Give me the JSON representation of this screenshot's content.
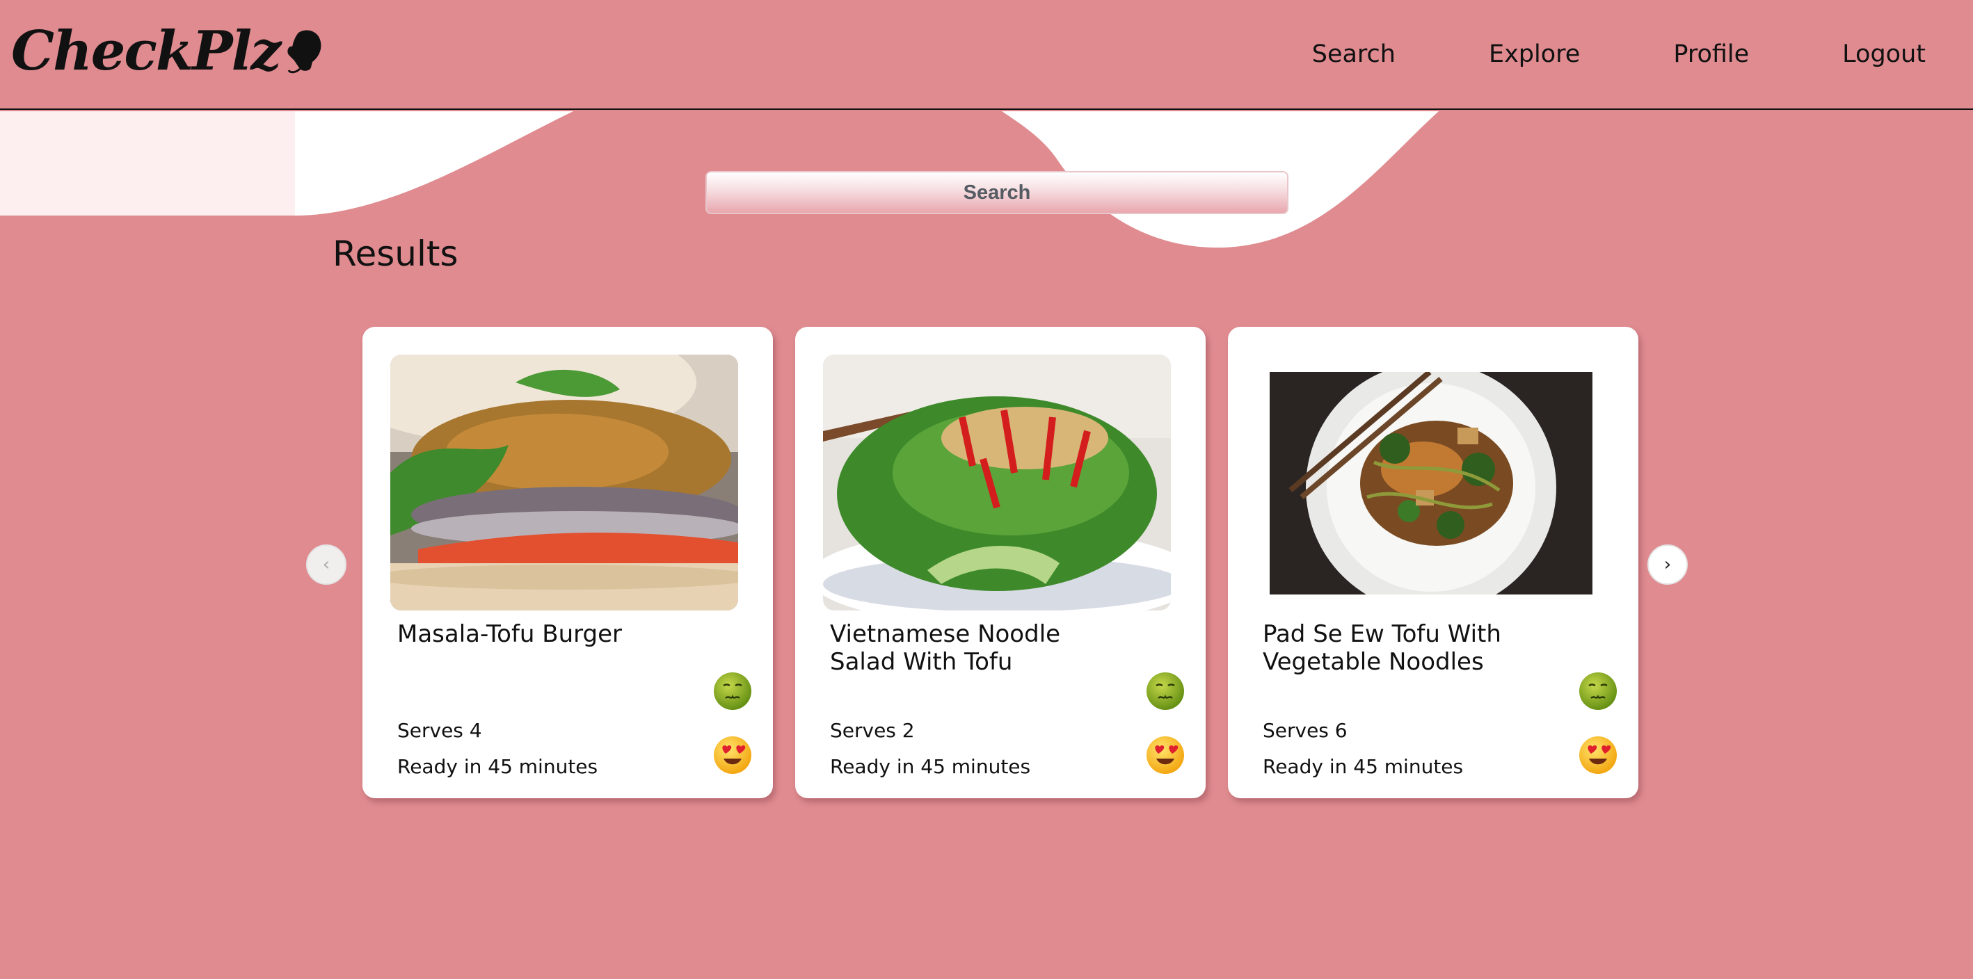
{
  "app": {
    "logo_text": "CheckPlz"
  },
  "nav": {
    "links": [
      {
        "label": "Search"
      },
      {
        "label": "Explore"
      },
      {
        "label": "Profile"
      },
      {
        "label": "Logout"
      }
    ]
  },
  "search": {
    "placeholder": "Search"
  },
  "results": {
    "title": "Results"
  },
  "carousel": {
    "prev_label": "‹",
    "next_label": "›"
  },
  "cards": [
    {
      "title": "Masala-Tofu Burger",
      "serves": "Serves 4",
      "ready": "Ready in 45 minutes"
    },
    {
      "title": "Vietnamese Noodle Salad With Tofu",
      "serves": "Serves 2",
      "ready": "Ready in 45 minutes"
    },
    {
      "title": "Pad Se Ew Tofu With Vegetable Noodles",
      "serves": "Serves 6",
      "ready": "Ready in 45 minutes"
    }
  ],
  "icons": {
    "dislike": "nauseated-face-icon",
    "like": "heart-eyes-face-icon"
  },
  "colors": {
    "background": "#df8b90",
    "card": "#ffffff",
    "accent_light": "#fdeff0"
  }
}
